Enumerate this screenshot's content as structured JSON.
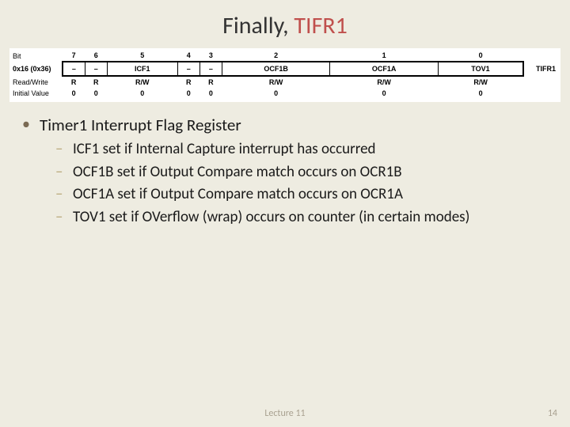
{
  "title": {
    "text1": "Finally, ",
    "accent": "TIFR1"
  },
  "register": {
    "rowLabels": {
      "bit": "Bit",
      "addr": "0x16 (0x36)",
      "rw": "Read/Write",
      "init": "Initial Value"
    },
    "regName": "TIFR1",
    "bits": [
      "7",
      "6",
      "5",
      "4",
      "3",
      "2",
      "1",
      "0"
    ],
    "names": [
      "–",
      "–",
      "ICF1",
      "–",
      "–",
      "OCF1B",
      "OCF1A",
      "TOV1"
    ],
    "rw": [
      "R",
      "R",
      "R/W",
      "R",
      "R",
      "R/W",
      "R/W",
      "R/W"
    ],
    "init": [
      "0",
      "0",
      "0",
      "0",
      "0",
      "0",
      "0",
      "0"
    ]
  },
  "bullets": {
    "main": "Timer1 Interrupt Flag Register",
    "sub": [
      "ICF1 set if Internal Capture interrupt has occurred",
      "OCF1B set if Output Compare match occurs on OCR1B",
      "OCF1A set if Output Compare match occurs on OCR1A",
      "TOV1 set if OVerflow (wrap) occurs on counter (in certain modes)"
    ]
  },
  "footer": {
    "center": "Lecture 11",
    "page": "14"
  }
}
